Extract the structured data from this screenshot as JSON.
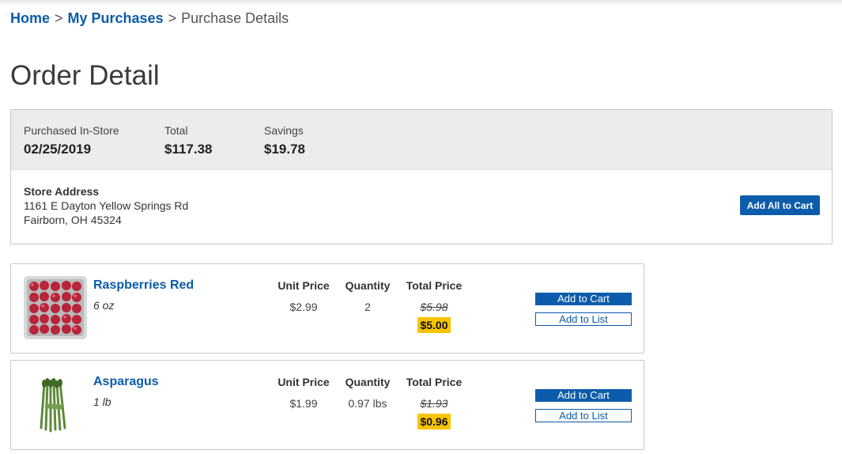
{
  "breadcrumb": {
    "home": "Home",
    "separator": ">",
    "purchases": "My Purchases",
    "current": "Purchase Details"
  },
  "page_title": "Order Detail",
  "summary": {
    "purchased_label": "Purchased In-Store",
    "purchased_date": "02/25/2019",
    "total_label": "Total",
    "total_value": "$117.38",
    "savings_label": "Savings",
    "savings_value": "$19.78",
    "store_address_label": "Store Address",
    "address_line1": "1161 E Dayton Yellow Springs Rd",
    "address_line2": "Fairborn, OH 45324",
    "add_all_label": "Add All to Cart"
  },
  "columns": {
    "unit_price": "Unit Price",
    "quantity": "Quantity",
    "total_price": "Total Price"
  },
  "items": [
    {
      "name": "Raspberries Red",
      "size": "6 oz",
      "unit_price": "$2.99",
      "quantity": "2",
      "original_total": "$5.98",
      "sale_total": "$5.00",
      "image_icon": "raspberries-image",
      "add_to_cart": "Add to Cart",
      "add_to_list": "Add to List"
    },
    {
      "name": "Asparagus",
      "size": "1 lb",
      "unit_price": "$1.99",
      "quantity": "0.97 lbs",
      "original_total": "$1.93",
      "sale_total": "$0.96",
      "image_icon": "asparagus-image",
      "add_to_cart": "Add to Cart",
      "add_to_list": "Add to List"
    }
  ],
  "colors": {
    "link_blue": "#0a5ca8",
    "button_blue": "#0d5cab",
    "sale_highlight": "#f6c400",
    "summary_header_bg": "#ececec"
  }
}
